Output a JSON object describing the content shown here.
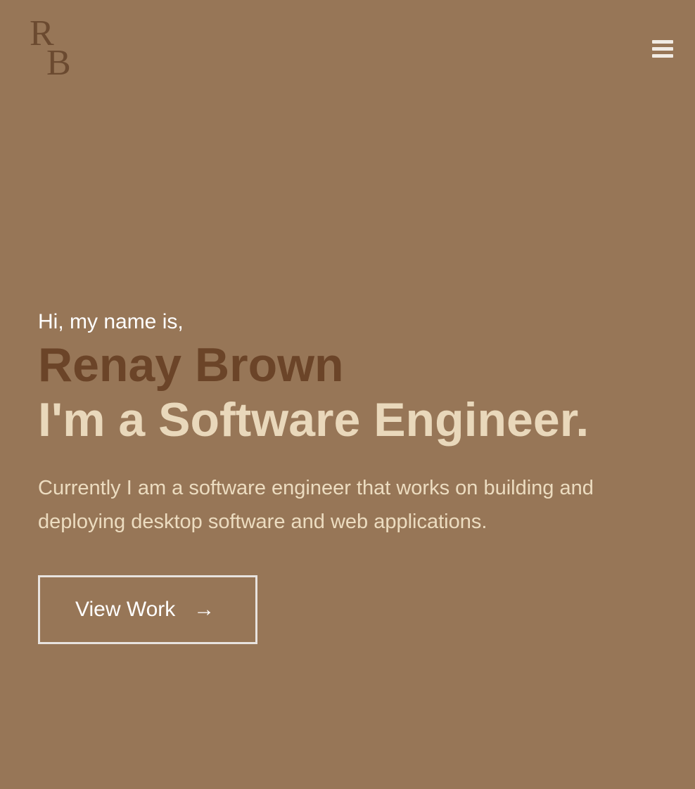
{
  "header": {
    "logo": {
      "letter_1": "R",
      "letter_2": "B"
    },
    "menu_icon": "hamburger-menu-icon"
  },
  "hero": {
    "greeting": "Hi, my name is,",
    "name": "Renay Brown",
    "tagline": "I'm a Software Engineer.",
    "description": "Currently I am a software engineer that works on building and deploying desktop software and web applications.",
    "cta_label": "View Work",
    "cta_icon": "arrow-right-icon",
    "cta_arrow": "→"
  },
  "colors": {
    "background": "#977657",
    "name": "#6b4428",
    "tagline": "#e9d8bb",
    "description": "#ecdcc0",
    "logo": "#6b4a30",
    "button_border": "#e8e3df"
  }
}
